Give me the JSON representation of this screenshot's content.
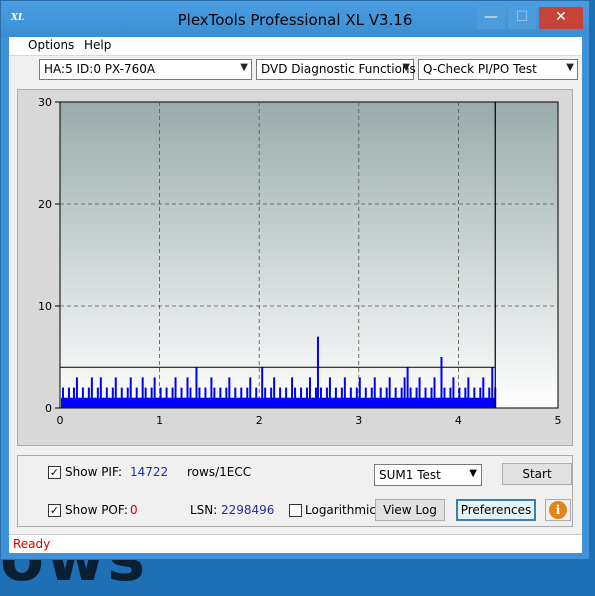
{
  "window": {
    "title": "PlexTools Professional XL V3.16",
    "app_icon_text": "XL",
    "minimize_glyph": "—",
    "maximize_glyph": "☐",
    "close_glyph": "✕"
  },
  "desktop_text": "ows",
  "menu": {
    "options_label": "Options",
    "help_label": "Help"
  },
  "toolbar": {
    "drive_select": "HA:5 ID:0  PX-760A",
    "function_select": "DVD Diagnostic Functions",
    "test_select": "Q-Check PI/PO Test"
  },
  "chart_data": {
    "type": "bar",
    "xlim": [
      0,
      5
    ],
    "ylim": [
      0,
      30
    ],
    "x_ticks": [
      "0",
      "1",
      "2",
      "3",
      "4",
      "5"
    ],
    "y_ticks": [
      "0",
      "10",
      "20",
      "30"
    ],
    "grid": true,
    "end_marker_x": 4.37,
    "threshold_y": 4,
    "series": [
      {
        "color": "#0000ff",
        "points": [
          [
            0.02,
            2
          ],
          [
            0.05,
            1
          ],
          [
            0.08,
            2
          ],
          [
            0.1,
            1
          ],
          [
            0.13,
            2
          ],
          [
            0.16,
            3
          ],
          [
            0.19,
            1
          ],
          [
            0.22,
            2
          ],
          [
            0.25,
            1
          ],
          [
            0.28,
            2
          ],
          [
            0.31,
            3
          ],
          [
            0.34,
            1
          ],
          [
            0.37,
            2
          ],
          [
            0.4,
            3
          ],
          [
            0.43,
            1
          ],
          [
            0.46,
            2
          ],
          [
            0.49,
            1
          ],
          [
            0.52,
            2
          ],
          [
            0.55,
            3
          ],
          [
            0.58,
            1
          ],
          [
            0.61,
            2
          ],
          [
            0.64,
            1
          ],
          [
            0.67,
            2
          ],
          [
            0.7,
            3
          ],
          [
            0.73,
            1
          ],
          [
            0.76,
            2
          ],
          [
            0.79,
            1
          ],
          [
            0.82,
            3
          ],
          [
            0.85,
            2
          ],
          [
            0.88,
            1
          ],
          [
            0.91,
            2
          ],
          [
            0.94,
            3
          ],
          [
            0.97,
            1
          ],
          [
            1.0,
            2
          ],
          [
            1.03,
            1
          ],
          [
            1.06,
            2
          ],
          [
            1.09,
            1
          ],
          [
            1.12,
            2
          ],
          [
            1.15,
            3
          ],
          [
            1.18,
            1
          ],
          [
            1.21,
            2
          ],
          [
            1.24,
            1
          ],
          [
            1.27,
            3
          ],
          [
            1.3,
            2
          ],
          [
            1.33,
            1
          ],
          [
            1.36,
            4
          ],
          [
            1.39,
            2
          ],
          [
            1.42,
            1
          ],
          [
            1.45,
            2
          ],
          [
            1.48,
            1
          ],
          [
            1.51,
            3
          ],
          [
            1.54,
            2
          ],
          [
            1.57,
            1
          ],
          [
            1.6,
            2
          ],
          [
            1.63,
            1
          ],
          [
            1.66,
            2
          ],
          [
            1.69,
            3
          ],
          [
            1.72,
            1
          ],
          [
            1.75,
            2
          ],
          [
            1.78,
            1
          ],
          [
            1.81,
            2
          ],
          [
            1.84,
            1
          ],
          [
            1.87,
            2
          ],
          [
            1.9,
            3
          ],
          [
            1.93,
            1
          ],
          [
            1.96,
            2
          ],
          [
            1.99,
            1
          ],
          [
            2.02,
            4
          ],
          [
            2.05,
            2
          ],
          [
            2.08,
            1
          ],
          [
            2.11,
            2
          ],
          [
            2.14,
            3
          ],
          [
            2.17,
            1
          ],
          [
            2.2,
            2
          ],
          [
            2.23,
            1
          ],
          [
            2.26,
            2
          ],
          [
            2.29,
            1
          ],
          [
            2.32,
            3
          ],
          [
            2.35,
            2
          ],
          [
            2.38,
            1
          ],
          [
            2.41,
            2
          ],
          [
            2.44,
            1
          ],
          [
            2.47,
            2
          ],
          [
            2.5,
            3
          ],
          [
            2.53,
            1
          ],
          [
            2.56,
            2
          ],
          [
            2.58,
            7
          ],
          [
            2.61,
            2
          ],
          [
            2.64,
            1
          ],
          [
            2.67,
            2
          ],
          [
            2.7,
            3
          ],
          [
            2.73,
            1
          ],
          [
            2.76,
            2
          ],
          [
            2.79,
            1
          ],
          [
            2.82,
            2
          ],
          [
            2.85,
            3
          ],
          [
            2.88,
            1
          ],
          [
            2.91,
            2
          ],
          [
            2.94,
            1
          ],
          [
            2.97,
            2
          ],
          [
            3.0,
            3
          ],
          [
            3.03,
            1
          ],
          [
            3.06,
            2
          ],
          [
            3.09,
            1
          ],
          [
            3.12,
            2
          ],
          [
            3.15,
            3
          ],
          [
            3.18,
            1
          ],
          [
            3.21,
            2
          ],
          [
            3.24,
            1
          ],
          [
            3.27,
            2
          ],
          [
            3.3,
            3
          ],
          [
            3.33,
            1
          ],
          [
            3.36,
            2
          ],
          [
            3.39,
            1
          ],
          [
            3.42,
            2
          ],
          [
            3.45,
            3
          ],
          [
            3.48,
            4
          ],
          [
            3.51,
            2
          ],
          [
            3.54,
            1
          ],
          [
            3.57,
            2
          ],
          [
            3.6,
            3
          ],
          [
            3.63,
            1
          ],
          [
            3.66,
            2
          ],
          [
            3.69,
            1
          ],
          [
            3.72,
            2
          ],
          [
            3.75,
            3
          ],
          [
            3.78,
            1
          ],
          [
            3.82,
            5
          ],
          [
            3.85,
            2
          ],
          [
            3.88,
            1
          ],
          [
            3.91,
            2
          ],
          [
            3.94,
            3
          ],
          [
            3.97,
            1
          ],
          [
            4.0,
            2
          ],
          [
            4.03,
            1
          ],
          [
            4.06,
            2
          ],
          [
            4.09,
            3
          ],
          [
            4.12,
            1
          ],
          [
            4.15,
            2
          ],
          [
            4.18,
            1
          ],
          [
            4.21,
            2
          ],
          [
            4.24,
            3
          ],
          [
            4.27,
            1
          ],
          [
            4.3,
            2
          ],
          [
            4.33,
            4
          ],
          [
            4.36,
            2
          ]
        ]
      }
    ]
  },
  "controls": {
    "show_pif_label": "Show PIF:",
    "show_pif_checked": "✓",
    "pif_value": "14722",
    "rows_label": "rows/1ECC",
    "sum_select": "SUM1 Test",
    "start_label": "Start",
    "show_pof_label": "Show POF:",
    "show_pof_checked": "✓",
    "pof_value": "0",
    "lsn_label": "LSN:",
    "lsn_value": "2298496",
    "logarithmic_label": "Logarithmic",
    "logarithmic_checked": "",
    "view_log_label": "View Log",
    "preferences_label": "Preferences",
    "info_glyph": "i"
  },
  "status": {
    "text": "Ready"
  }
}
